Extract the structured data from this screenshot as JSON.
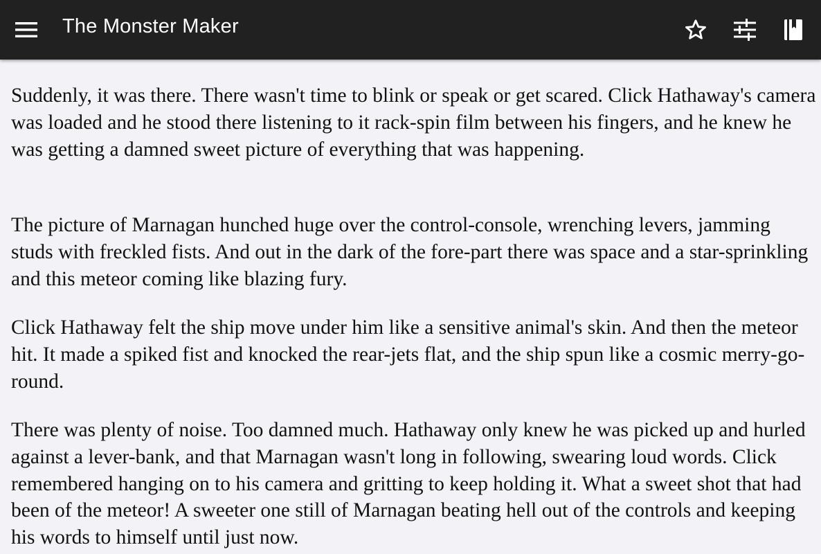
{
  "appbar": {
    "title": "The Monster Maker",
    "background": "#212121",
    "icons": [
      "menu-icon",
      "star-outline-icon",
      "tune-sliders-icon",
      "book-icon"
    ]
  },
  "reader": {
    "background": "#f3f3f7",
    "paragraphs": [
      "Suddenly, it was there. There wasn't time to blink or speak or get scared. Click Hathaway's camera was loaded and he stood there listening to it rack-spin film between his fingers, and he knew he was getting a damned sweet picture of everything that was happening.",
      "The picture of Marnagan hunched huge over the control-console, wrenching levers, jamming studs with freckled fists. And out in the dark of the fore-part there was space and a star-sprinkling and this meteor coming like blazing fury.",
      "Click Hathaway felt the ship move under him like a sensitive animal's skin. And then the meteor hit. It made a spiked fist and knocked the rear-jets flat, and the ship spun like a cosmic merry-go-round.",
      "There was plenty of noise. Too damned much. Hathaway only knew he was picked up and hurled against a lever-bank, and that Marnagan wasn't long in following, swearing loud words. Click remembered hanging on to his camera and gritting to keep holding it. What a sweet shot that had been of the meteor! A sweeter one still of Marnagan beating hell out of the controls and keeping his words to himself until just now."
    ]
  }
}
